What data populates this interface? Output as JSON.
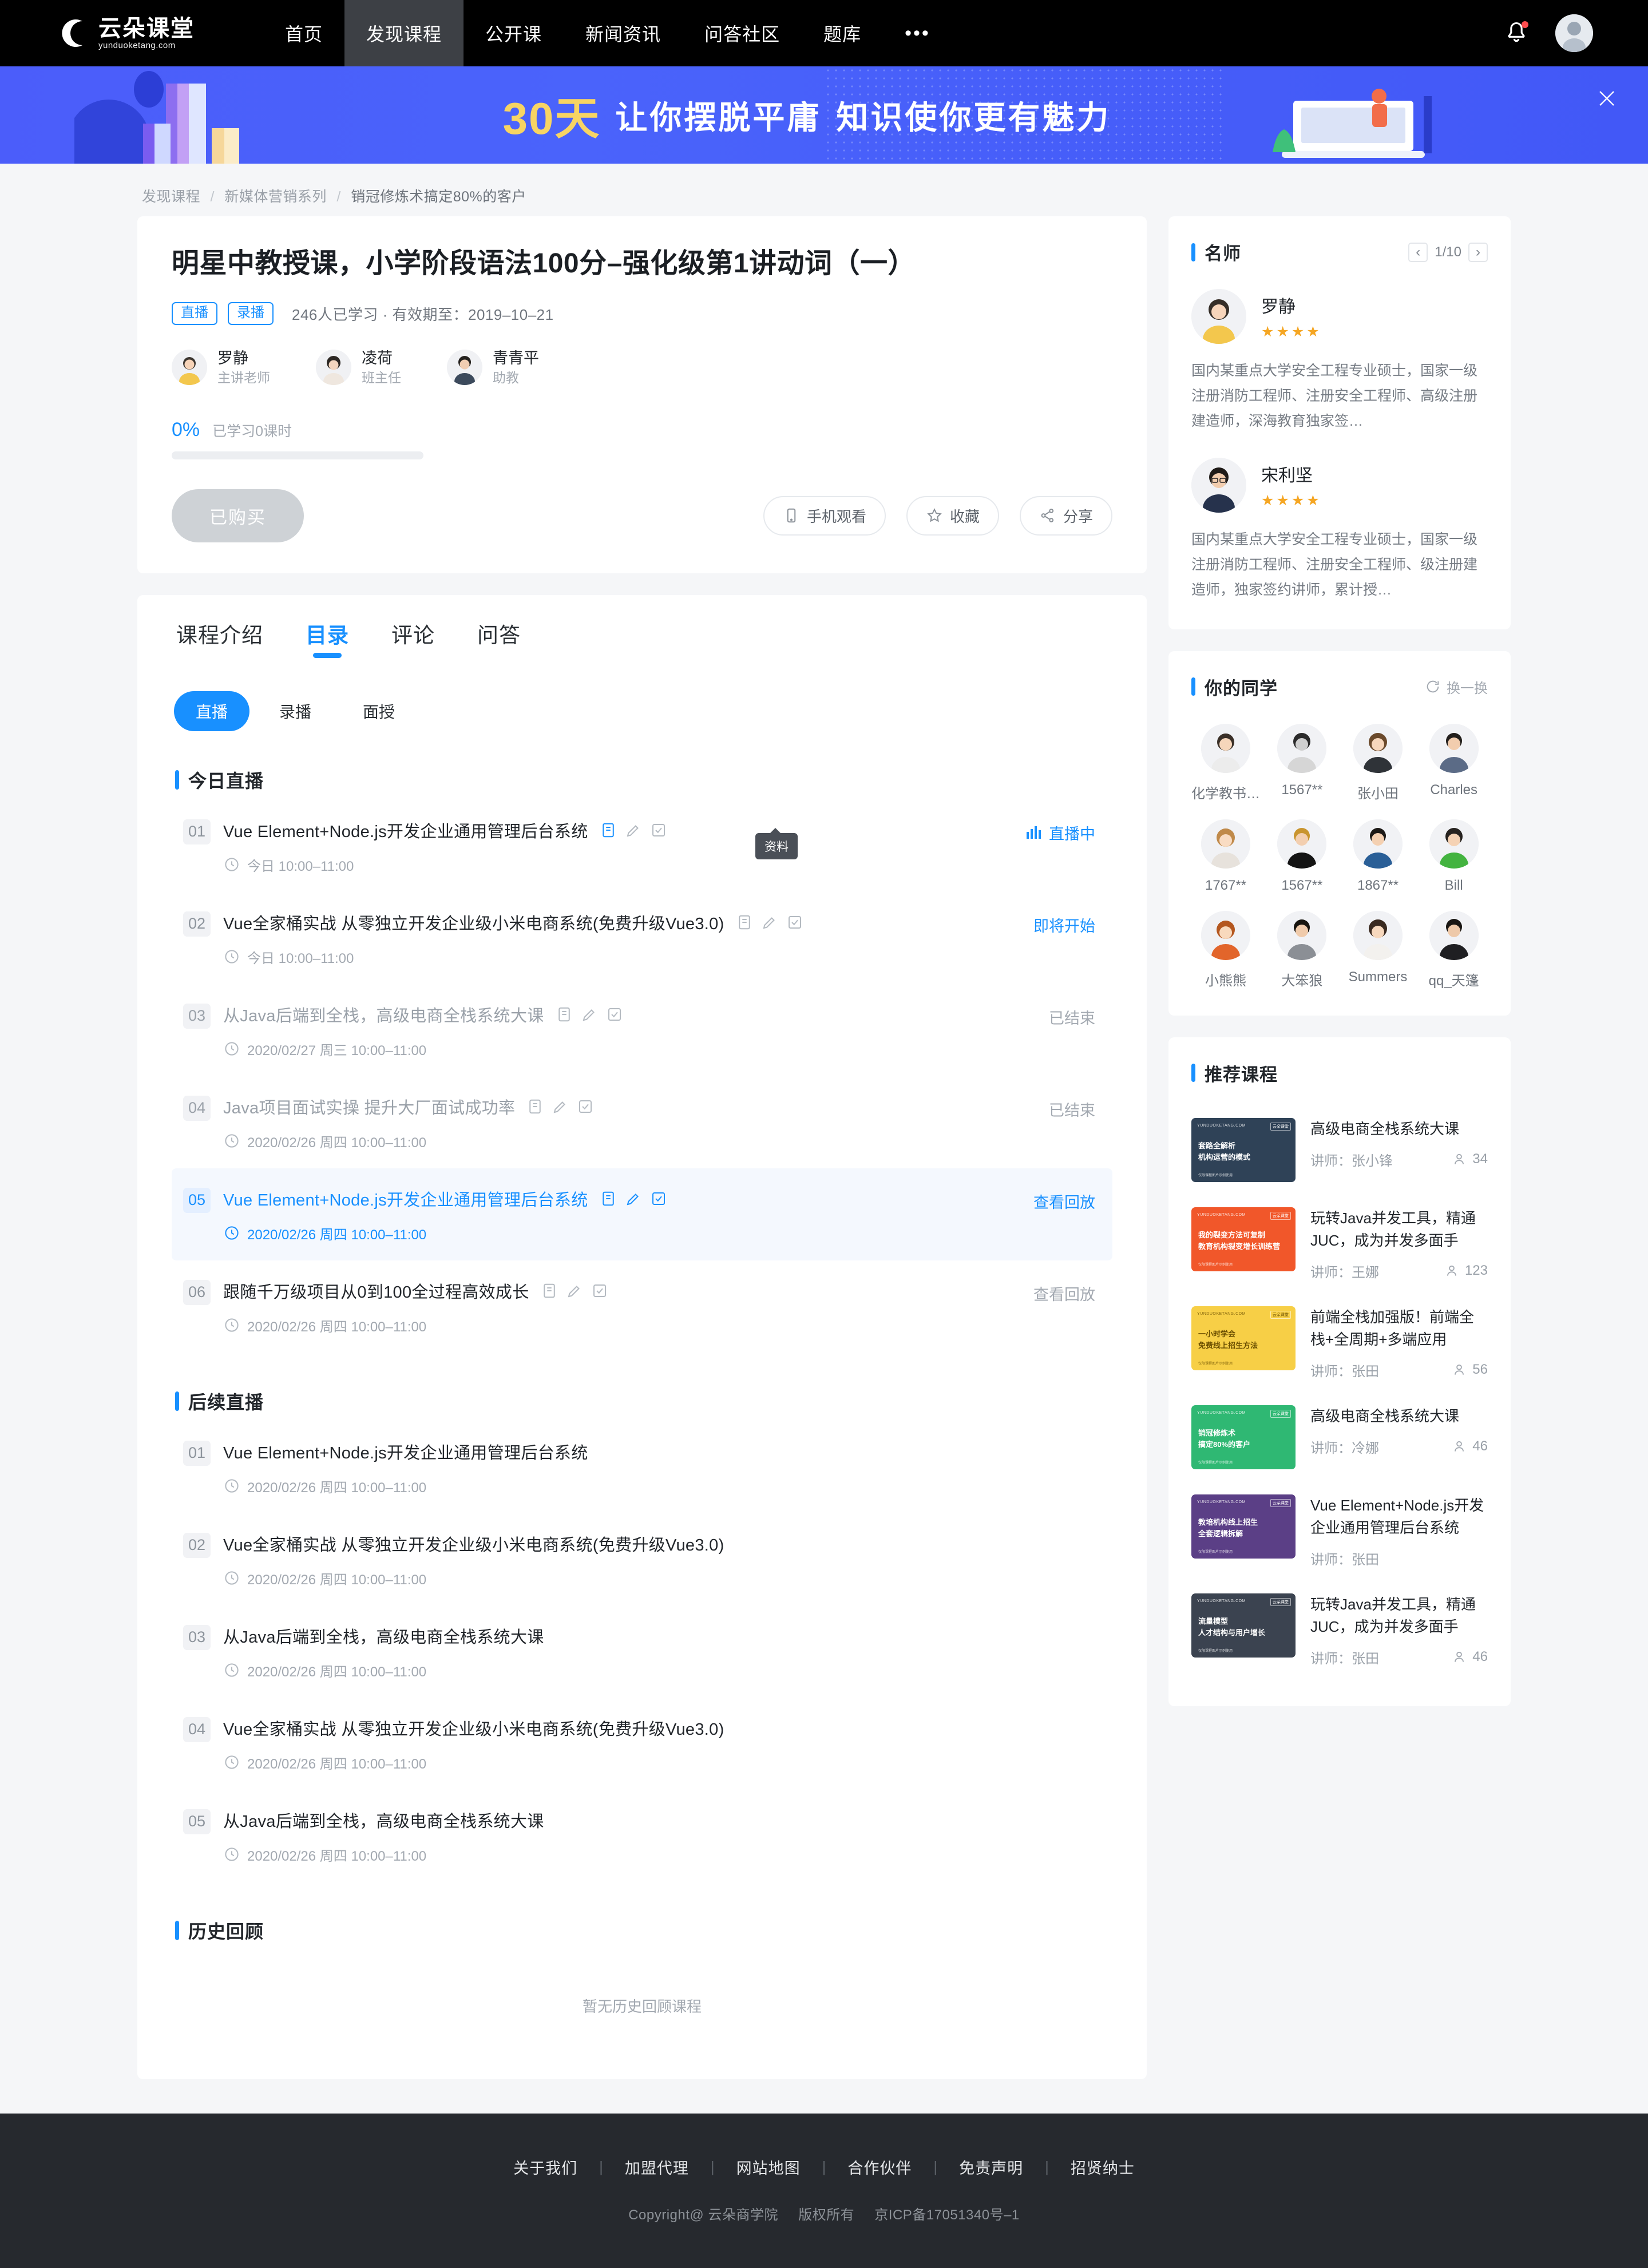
{
  "nav": {
    "logo_cn": "云朵课堂",
    "logo_en": "yunduoketang.com",
    "items": [
      "首页",
      "发现课程",
      "公开课",
      "新闻资讯",
      "问答社区",
      "题库"
    ],
    "more": "•••",
    "active_index": 1
  },
  "banner": {
    "highlight": "30天",
    "text1": "让你摆脱平庸",
    "text2": "知识使你更有魅力",
    "close_label": "×"
  },
  "breadcrumb": [
    "发现课程",
    "新媒体营销系列",
    "销冠修炼术搞定80%的客户"
  ],
  "course": {
    "title": "明星中教授课，小学阶段语法100分–强化级第1讲动词（一）",
    "tags": [
      "直播",
      "录播"
    ],
    "meta": "246人已学习 · 有效期至：2019–10–21",
    "teachers": [
      {
        "name": "罗静",
        "role": "主讲老师"
      },
      {
        "name": "凌荷",
        "role": "班主任"
      },
      {
        "name": "青青平",
        "role": "助教"
      }
    ],
    "progress_pct": "0%",
    "progress_label": "已学习0课时",
    "progress_value": 0,
    "buy_button": "已购买",
    "actions": [
      {
        "label": "手机观看",
        "icon": "mobile-icon"
      },
      {
        "label": "收藏",
        "icon": "star-icon"
      },
      {
        "label": "分享",
        "icon": "share-icon"
      }
    ]
  },
  "tabs": {
    "items": [
      "课程介绍",
      "目录",
      "评论",
      "问答"
    ],
    "active_index": 1,
    "subtabs": [
      "直播",
      "录播",
      "面授"
    ],
    "sub_active_index": 0
  },
  "sections": [
    {
      "title": "今日直播",
      "lessons": [
        {
          "num": "01",
          "title": "Vue Element+Node.js开发企业通用管理后台系统",
          "time": "今日 10:00–11:00",
          "status": "直播中",
          "state": "live",
          "icons": true,
          "tooltip": "资料"
        },
        {
          "num": "02",
          "title": "Vue全家桶实战 从零独立开发企业级小米电商系统(免费升级Vue3.0)",
          "time": "今日 10:00–11:00",
          "status": "即将开始",
          "state": "soon",
          "icons": true
        },
        {
          "num": "03",
          "title": "从Java后端到全栈，高级电商全栈系统大课",
          "time": "2020/02/27 周三 10:00–11:00",
          "status": "已结束",
          "state": "past",
          "icons": true
        },
        {
          "num": "04",
          "title": "Java项目面试实操 提升大厂面试成功率",
          "time": "2020/02/26 周四 10:00–11:00",
          "status": "已结束",
          "state": "past",
          "icons": true
        },
        {
          "num": "05",
          "title": "Vue Element+Node.js开发企业通用管理后台系统",
          "time": "2020/02/26 周四 10:00–11:00",
          "status": "查看回放",
          "state": "highlight",
          "icons": true
        },
        {
          "num": "06",
          "title": "跟随千万级项目从0到100全过程高效成长",
          "time": "2020/02/26 周四 10:00–11:00",
          "status": "查看回放",
          "state": "past",
          "icons": true
        }
      ]
    },
    {
      "title": "后续直播",
      "lessons": [
        {
          "num": "01",
          "title": "Vue Element+Node.js开发企业通用管理后台系统",
          "time": "2020/02/26 周四 10:00–11:00",
          "status": "",
          "state": "plain",
          "icons": false
        },
        {
          "num": "02",
          "title": "Vue全家桶实战 从零独立开发企业级小米电商系统(免费升级Vue3.0)",
          "time": "2020/02/26 周四 10:00–11:00",
          "status": "",
          "state": "plain",
          "icons": false
        },
        {
          "num": "03",
          "title": "从Java后端到全栈，高级电商全栈系统大课",
          "time": "2020/02/26 周四 10:00–11:00",
          "status": "",
          "state": "plain",
          "icons": false
        },
        {
          "num": "04",
          "title": "Vue全家桶实战 从零独立开发企业级小米电商系统(免费升级Vue3.0)",
          "time": "2020/02/26 周四 10:00–11:00",
          "status": "",
          "state": "plain",
          "icons": false
        },
        {
          "num": "05",
          "title": "从Java后端到全栈，高级电商全栈系统大课",
          "time": "2020/02/26 周四 10:00–11:00",
          "status": "",
          "state": "plain",
          "icons": false
        }
      ]
    },
    {
      "title": "历史回顾",
      "lessons": [],
      "empty_text": "暂无历史回顾课程"
    }
  ],
  "sidebar": {
    "famous_teachers": {
      "title": "名师",
      "page": "1/10",
      "prev": "‹",
      "next": "›",
      "list": [
        {
          "name": "罗静",
          "stars": 4,
          "desc": "国内某重点大学安全工程专业硕士，国家一级注册消防工程师、注册安全工程师、高级注册建造师，深海教育独家签…"
        },
        {
          "name": "宋利坚",
          "stars": 4,
          "desc": "国内某重点大学安全工程专业硕士，国家一级注册消防工程师、注册安全工程师、级注册建造师，独家签约讲师，累计授…"
        }
      ]
    },
    "classmates": {
      "title": "你的同学",
      "swap_label": "换一换",
      "list": [
        {
          "name": "化学教书…"
        },
        {
          "name": "1567**"
        },
        {
          "name": "张小田"
        },
        {
          "name": "Charles"
        },
        {
          "name": "1767**"
        },
        {
          "name": "1567**"
        },
        {
          "name": "1867**"
        },
        {
          "name": "Bill"
        },
        {
          "name": "小熊熊"
        },
        {
          "name": "大笨狼"
        },
        {
          "name": "Summers"
        },
        {
          "name": "qq_天篷"
        }
      ]
    },
    "recommended": {
      "title": "推荐课程",
      "teacher_prefix": "讲师：",
      "list": [
        {
          "title": "高级电商全栈系统大课",
          "teacher": "张小锋",
          "count": "34",
          "thumb_color": "#2f4257",
          "thumb_l1": "套路全解析",
          "thumb_l2": "机构运营的模式",
          "thumb_top": "YUNDUOKETANG.COM",
          "thumb_badge": "云朵课堂",
          "thumb_foot": "仅限课程图片示例使用"
        },
        {
          "title": "玩转Java并发工具，精通JUC，成为并发多面手",
          "teacher": "王娜",
          "count": "123",
          "thumb_color": "#f1572a",
          "thumb_l1": "我的裂变方法可复制",
          "thumb_l2": "教育机构裂变增长训练营",
          "thumb_top": "YUNDUOKETANG.COM",
          "thumb_badge": "云朵课堂",
          "thumb_foot": "仅限课程图片示例使用"
        },
        {
          "title": "前端全栈加强版！前端全栈+全周期+多端应用",
          "teacher": "张田",
          "count": "56",
          "thumb_color": "#f7cf46",
          "thumb_l1": "一小时学会",
          "thumb_l2": "免费线上招生方法",
          "thumb_top": "YUNDUOKETANG.COM",
          "thumb_badge": "云朵课堂",
          "thumb_foot": "仅限课程图片示例使用"
        },
        {
          "title": "高级电商全栈系统大课",
          "teacher": "冷娜",
          "count": "46",
          "thumb_color": "#2fb873",
          "thumb_l1": "销冠修炼术",
          "thumb_l2": "搞定80%的客户",
          "thumb_top": "YUNDUOKETANG.COM",
          "thumb_badge": "云朵课堂",
          "thumb_foot": "仅限课程图片示例使用"
        },
        {
          "title": "Vue Element+Node.js开发企业通用管理后台系统",
          "teacher": "张田",
          "count": "",
          "thumb_color": "#5b3f86",
          "thumb_l1": "教培机构线上招生",
          "thumb_l2": "全套逻辑拆解",
          "thumb_top": "YUNDUOKETANG.COM",
          "thumb_badge": "云朵课堂",
          "thumb_foot": "仅限课程图片示例使用"
        },
        {
          "title": "玩转Java并发工具，精通JUC，成为并发多面手",
          "teacher": "张田",
          "count": "46",
          "thumb_color": "#3b4350",
          "thumb_l1": "流量模型",
          "thumb_l2": "人才结构与用户增长",
          "thumb_top": "YUNDUOKETANG.COM",
          "thumb_badge": "云朵课堂",
          "thumb_foot": "仅限课程图片示例使用"
        }
      ]
    }
  },
  "footer": {
    "links": [
      "关于我们",
      "加盟代理",
      "网站地图",
      "合作伙伴",
      "免责声明",
      "招贤纳士"
    ],
    "divider": "|",
    "copyright": "Copyright@ 云朵商学院",
    "rights": "版权所有",
    "icp": "京ICP备17051340号–1"
  }
}
